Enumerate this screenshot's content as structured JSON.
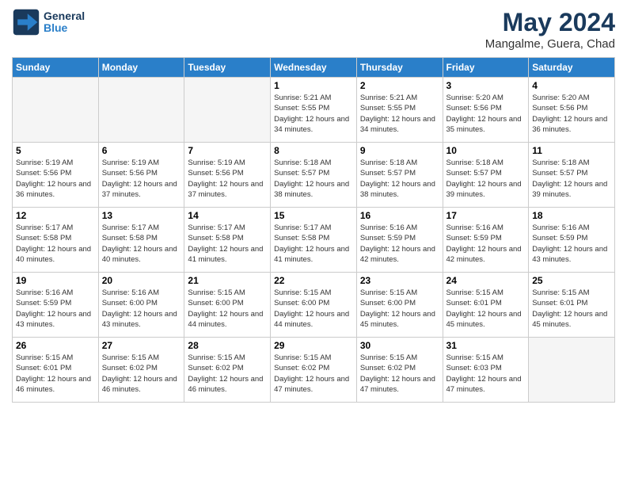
{
  "header": {
    "logo_line1": "General",
    "logo_line2": "Blue",
    "month": "May 2024",
    "location": "Mangalme, Guera, Chad"
  },
  "weekdays": [
    "Sunday",
    "Monday",
    "Tuesday",
    "Wednesday",
    "Thursday",
    "Friday",
    "Saturday"
  ],
  "weeks": [
    [
      {
        "day": "",
        "sunrise": "",
        "sunset": "",
        "daylight": ""
      },
      {
        "day": "",
        "sunrise": "",
        "sunset": "",
        "daylight": ""
      },
      {
        "day": "",
        "sunrise": "",
        "sunset": "",
        "daylight": ""
      },
      {
        "day": "1",
        "sunrise": "Sunrise: 5:21 AM",
        "sunset": "Sunset: 5:55 PM",
        "daylight": "Daylight: 12 hours and 34 minutes."
      },
      {
        "day": "2",
        "sunrise": "Sunrise: 5:21 AM",
        "sunset": "Sunset: 5:55 PM",
        "daylight": "Daylight: 12 hours and 34 minutes."
      },
      {
        "day": "3",
        "sunrise": "Sunrise: 5:20 AM",
        "sunset": "Sunset: 5:56 PM",
        "daylight": "Daylight: 12 hours and 35 minutes."
      },
      {
        "day": "4",
        "sunrise": "Sunrise: 5:20 AM",
        "sunset": "Sunset: 5:56 PM",
        "daylight": "Daylight: 12 hours and 36 minutes."
      }
    ],
    [
      {
        "day": "5",
        "sunrise": "Sunrise: 5:19 AM",
        "sunset": "Sunset: 5:56 PM",
        "daylight": "Daylight: 12 hours and 36 minutes."
      },
      {
        "day": "6",
        "sunrise": "Sunrise: 5:19 AM",
        "sunset": "Sunset: 5:56 PM",
        "daylight": "Daylight: 12 hours and 37 minutes."
      },
      {
        "day": "7",
        "sunrise": "Sunrise: 5:19 AM",
        "sunset": "Sunset: 5:56 PM",
        "daylight": "Daylight: 12 hours and 37 minutes."
      },
      {
        "day": "8",
        "sunrise": "Sunrise: 5:18 AM",
        "sunset": "Sunset: 5:57 PM",
        "daylight": "Daylight: 12 hours and 38 minutes."
      },
      {
        "day": "9",
        "sunrise": "Sunrise: 5:18 AM",
        "sunset": "Sunset: 5:57 PM",
        "daylight": "Daylight: 12 hours and 38 minutes."
      },
      {
        "day": "10",
        "sunrise": "Sunrise: 5:18 AM",
        "sunset": "Sunset: 5:57 PM",
        "daylight": "Daylight: 12 hours and 39 minutes."
      },
      {
        "day": "11",
        "sunrise": "Sunrise: 5:18 AM",
        "sunset": "Sunset: 5:57 PM",
        "daylight": "Daylight: 12 hours and 39 minutes."
      }
    ],
    [
      {
        "day": "12",
        "sunrise": "Sunrise: 5:17 AM",
        "sunset": "Sunset: 5:58 PM",
        "daylight": "Daylight: 12 hours and 40 minutes."
      },
      {
        "day": "13",
        "sunrise": "Sunrise: 5:17 AM",
        "sunset": "Sunset: 5:58 PM",
        "daylight": "Daylight: 12 hours and 40 minutes."
      },
      {
        "day": "14",
        "sunrise": "Sunrise: 5:17 AM",
        "sunset": "Sunset: 5:58 PM",
        "daylight": "Daylight: 12 hours and 41 minutes."
      },
      {
        "day": "15",
        "sunrise": "Sunrise: 5:17 AM",
        "sunset": "Sunset: 5:58 PM",
        "daylight": "Daylight: 12 hours and 41 minutes."
      },
      {
        "day": "16",
        "sunrise": "Sunrise: 5:16 AM",
        "sunset": "Sunset: 5:59 PM",
        "daylight": "Daylight: 12 hours and 42 minutes."
      },
      {
        "day": "17",
        "sunrise": "Sunrise: 5:16 AM",
        "sunset": "Sunset: 5:59 PM",
        "daylight": "Daylight: 12 hours and 42 minutes."
      },
      {
        "day": "18",
        "sunrise": "Sunrise: 5:16 AM",
        "sunset": "Sunset: 5:59 PM",
        "daylight": "Daylight: 12 hours and 43 minutes."
      }
    ],
    [
      {
        "day": "19",
        "sunrise": "Sunrise: 5:16 AM",
        "sunset": "Sunset: 5:59 PM",
        "daylight": "Daylight: 12 hours and 43 minutes."
      },
      {
        "day": "20",
        "sunrise": "Sunrise: 5:16 AM",
        "sunset": "Sunset: 6:00 PM",
        "daylight": "Daylight: 12 hours and 43 minutes."
      },
      {
        "day": "21",
        "sunrise": "Sunrise: 5:15 AM",
        "sunset": "Sunset: 6:00 PM",
        "daylight": "Daylight: 12 hours and 44 minutes."
      },
      {
        "day": "22",
        "sunrise": "Sunrise: 5:15 AM",
        "sunset": "Sunset: 6:00 PM",
        "daylight": "Daylight: 12 hours and 44 minutes."
      },
      {
        "day": "23",
        "sunrise": "Sunrise: 5:15 AM",
        "sunset": "Sunset: 6:00 PM",
        "daylight": "Daylight: 12 hours and 45 minutes."
      },
      {
        "day": "24",
        "sunrise": "Sunrise: 5:15 AM",
        "sunset": "Sunset: 6:01 PM",
        "daylight": "Daylight: 12 hours and 45 minutes."
      },
      {
        "day": "25",
        "sunrise": "Sunrise: 5:15 AM",
        "sunset": "Sunset: 6:01 PM",
        "daylight": "Daylight: 12 hours and 45 minutes."
      }
    ],
    [
      {
        "day": "26",
        "sunrise": "Sunrise: 5:15 AM",
        "sunset": "Sunset: 6:01 PM",
        "daylight": "Daylight: 12 hours and 46 minutes."
      },
      {
        "day": "27",
        "sunrise": "Sunrise: 5:15 AM",
        "sunset": "Sunset: 6:02 PM",
        "daylight": "Daylight: 12 hours and 46 minutes."
      },
      {
        "day": "28",
        "sunrise": "Sunrise: 5:15 AM",
        "sunset": "Sunset: 6:02 PM",
        "daylight": "Daylight: 12 hours and 46 minutes."
      },
      {
        "day": "29",
        "sunrise": "Sunrise: 5:15 AM",
        "sunset": "Sunset: 6:02 PM",
        "daylight": "Daylight: 12 hours and 47 minutes."
      },
      {
        "day": "30",
        "sunrise": "Sunrise: 5:15 AM",
        "sunset": "Sunset: 6:02 PM",
        "daylight": "Daylight: 12 hours and 47 minutes."
      },
      {
        "day": "31",
        "sunrise": "Sunrise: 5:15 AM",
        "sunset": "Sunset: 6:03 PM",
        "daylight": "Daylight: 12 hours and 47 minutes."
      },
      {
        "day": "",
        "sunrise": "",
        "sunset": "",
        "daylight": ""
      }
    ]
  ]
}
